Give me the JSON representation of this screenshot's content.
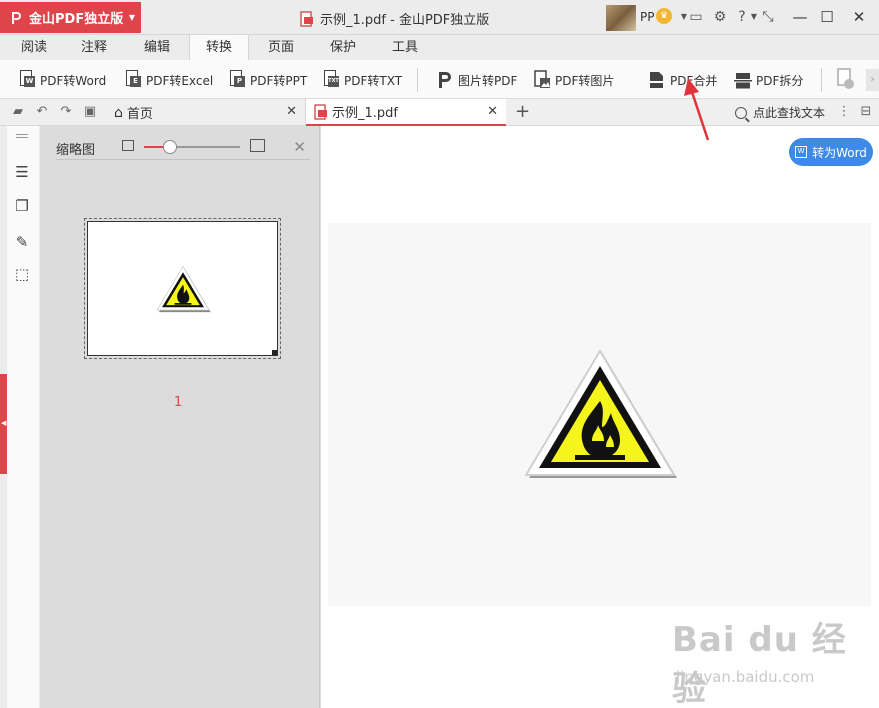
{
  "titlebar": {
    "app_name": "金山PDF独立版",
    "doc_title": "示例_1.pdf - 金山PDF独立版",
    "user": "PP",
    "icons": [
      "message-icon",
      "settings-icon",
      "help-icon",
      "shrink-icon"
    ],
    "help_label": "?"
  },
  "menu": {
    "tabs": [
      "阅读",
      "注释",
      "编辑",
      "转换",
      "页面",
      "保护",
      "工具"
    ],
    "active": "转换"
  },
  "ribbon": {
    "items": [
      {
        "label": "PDF转Word",
        "tag": "W"
      },
      {
        "label": "PDF转Excel",
        "tag": "E"
      },
      {
        "label": "PDF转PPT",
        "tag": "P"
      },
      {
        "label": "PDF转TXT",
        "tag": "TXT"
      },
      {
        "label": "图片转PDF",
        "tag": "P"
      },
      {
        "label": "PDF转图片",
        "tag": "img"
      },
      {
        "label": "PDF合并",
        "tag": "merge"
      },
      {
        "label": "PDF拆分",
        "tag": "split"
      }
    ]
  },
  "tabs": {
    "home": "首页",
    "current": "示例_1.pdf",
    "search_label": "点此查找文本"
  },
  "thumbnails": {
    "title": "缩略图",
    "page_number": "1",
    "zoom_level": 0.27
  },
  "main": {
    "to_word_label": "转为Word"
  },
  "watermark": {
    "brand": "Bai du 经验",
    "url": "jingyan.baidu.com"
  },
  "colors": {
    "accent": "#e0444b",
    "blue": "#3d8be6",
    "sign_yellow": "#f5f51c"
  }
}
